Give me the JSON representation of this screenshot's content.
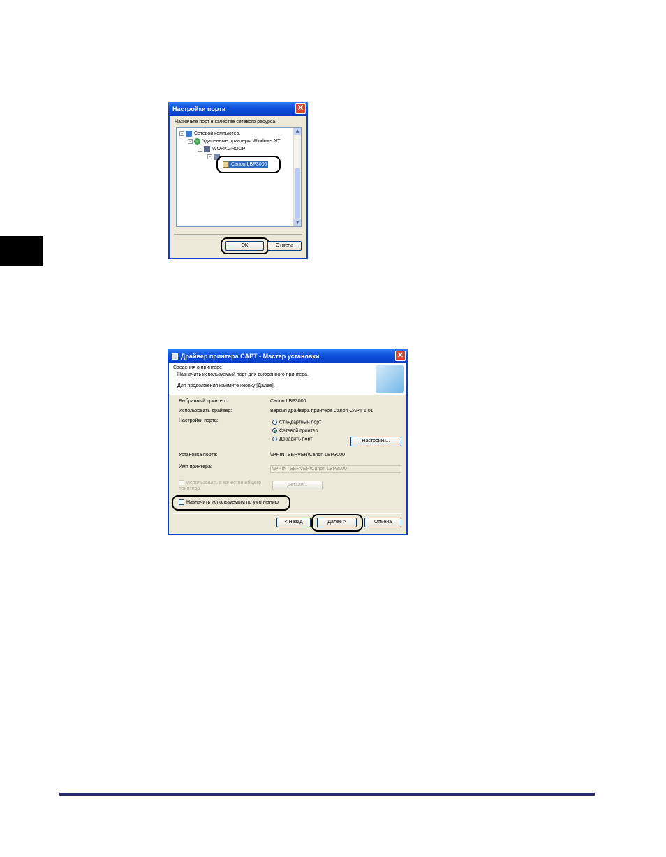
{
  "dialog1": {
    "title": "Настройки порта",
    "instruction": "Назначьте порт в качестве сетевого ресурса.",
    "tree": [
      {
        "label": "Сетевой компьютер.",
        "icon": "network-icon",
        "expander": "−"
      },
      {
        "label": "Удаленные принтеры Windows NT",
        "icon": "globe-icon",
        "expander": "−"
      },
      {
        "label": "WORKGROUP",
        "icon": "workgroup-icon",
        "expander": "−"
      },
      {
        "label": "Canon LBP3000",
        "icon": "printer-icon",
        "expander": ""
      }
    ],
    "ok_label": "OK",
    "cancel_label": "Отмена"
  },
  "dialog2": {
    "title": "Драйвер принтера CAPT - Мастер установки",
    "header_title": "Сведения о принтере",
    "header_desc": "Назначить используемый порт для выбранного принтера.",
    "header_hint": "Для продолжения нажмите кнопку [Далее].",
    "selected_printer_label": "Выбранный принтер:",
    "selected_printer_value": "Canon LBP3000",
    "driver_label": "Использовать драйвер:",
    "driver_value": "Версия драйвера принтера Canon CAPT 1.01",
    "port_settings_label": "Настройки порта:",
    "radio_options": [
      {
        "label": "Стандартный порт",
        "selected": false
      },
      {
        "label": "Сетевой принтер",
        "selected": true
      },
      {
        "label": "Добавить порт",
        "selected": false
      }
    ],
    "settings_button": "Настройки...",
    "port_setup_label": "Установка порта:",
    "port_setup_value": "\\\\PRINTSERVER\\Canon LBP3000",
    "printer_name_label": "Имя принтера:",
    "printer_name_value": "\\\\PRINTSERVER\\Canon LBP3000",
    "share_checkbox": "Использовать в качестве общего принтера",
    "details_button": "Детали...",
    "default_checkbox": "Назначить используемым по умолчанию",
    "back_button": "< Назад",
    "next_button": "Далее >",
    "cancel_button": "Отмена"
  }
}
